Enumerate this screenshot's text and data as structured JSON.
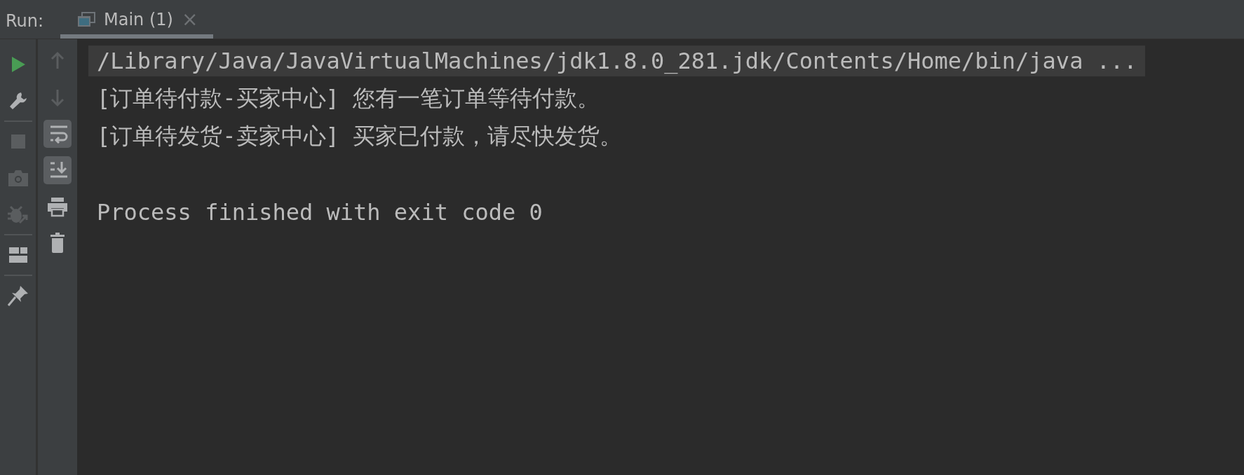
{
  "header": {
    "label": "Run:"
  },
  "tabs": [
    {
      "label": "Main (1)",
      "selected": true,
      "close": "×"
    }
  ],
  "left_toolbar": [
    {
      "kind": "run",
      "disabled": false
    },
    {
      "kind": "wrench",
      "disabled": false
    },
    {
      "kind": "separator"
    },
    {
      "kind": "stop",
      "disabled": true
    },
    {
      "kind": "camera",
      "disabled": true
    },
    {
      "kind": "bug",
      "disabled": true
    },
    {
      "kind": "separator"
    },
    {
      "kind": "layout",
      "disabled": false
    },
    {
      "kind": "separator"
    },
    {
      "kind": "pin",
      "disabled": false
    }
  ],
  "console_toolbar": [
    {
      "kind": "up",
      "disabled": true
    },
    {
      "kind": "down",
      "disabled": true
    },
    {
      "kind": "wrap",
      "disabled": false,
      "selected": true
    },
    {
      "kind": "scroll-end",
      "disabled": false,
      "selected": true
    },
    {
      "kind": "print",
      "disabled": false
    },
    {
      "kind": "trash",
      "disabled": false
    }
  ],
  "console": {
    "lines": [
      {
        "text": "/Library/Java/JavaVirtualMachines/jdk1.8.0_281.jdk/Contents/Home/bin/java ...",
        "kind": "command"
      },
      {
        "text": "[订单待付款-买家中心] 您有一笔订单等待付款。",
        "kind": "output"
      },
      {
        "text": "[订单待发货-卖家中心] 买家已付款，请尽快发货。",
        "kind": "output"
      },
      {
        "kind": "blank"
      },
      {
        "text": "Process finished with exit code 0",
        "kind": "output"
      }
    ]
  }
}
